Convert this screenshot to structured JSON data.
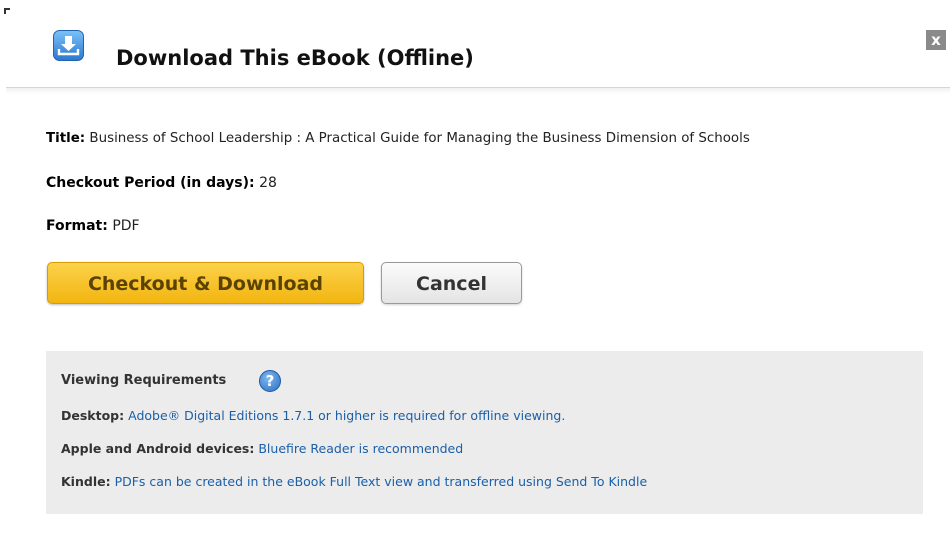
{
  "dialog": {
    "title": "Download This eBook (Offline)",
    "close_label": "x",
    "icon": "download-icon",
    "accent_color": "#3a8ee6"
  },
  "details": {
    "title_label": "Title:",
    "title_value": "Business of School Leadership : A Practical Guide for Managing the Business Dimension of Schools",
    "period_label": "Checkout Period (in days):",
    "period_value": "28",
    "format_label": "Format:",
    "format_value": "PDF"
  },
  "actions": {
    "checkout_label": "Checkout & Download",
    "cancel_label": "Cancel",
    "checkout_color": "#f6c223"
  },
  "requirements": {
    "heading": "Viewing Requirements",
    "help_icon": "question-icon",
    "help_glyph": "?",
    "desktop_label": "Desktop:",
    "desktop_text": "Adobe® Digital Editions 1.7.1 or higher is required for offline viewing.",
    "apple_label": "Apple and Android devices:",
    "apple_text": "Bluefire Reader is recommended",
    "kindle_label": "Kindle:",
    "kindle_text": "PDFs can be created in the eBook Full Text view and transferred using Send To Kindle",
    "link_color": "#1a5fa8"
  }
}
